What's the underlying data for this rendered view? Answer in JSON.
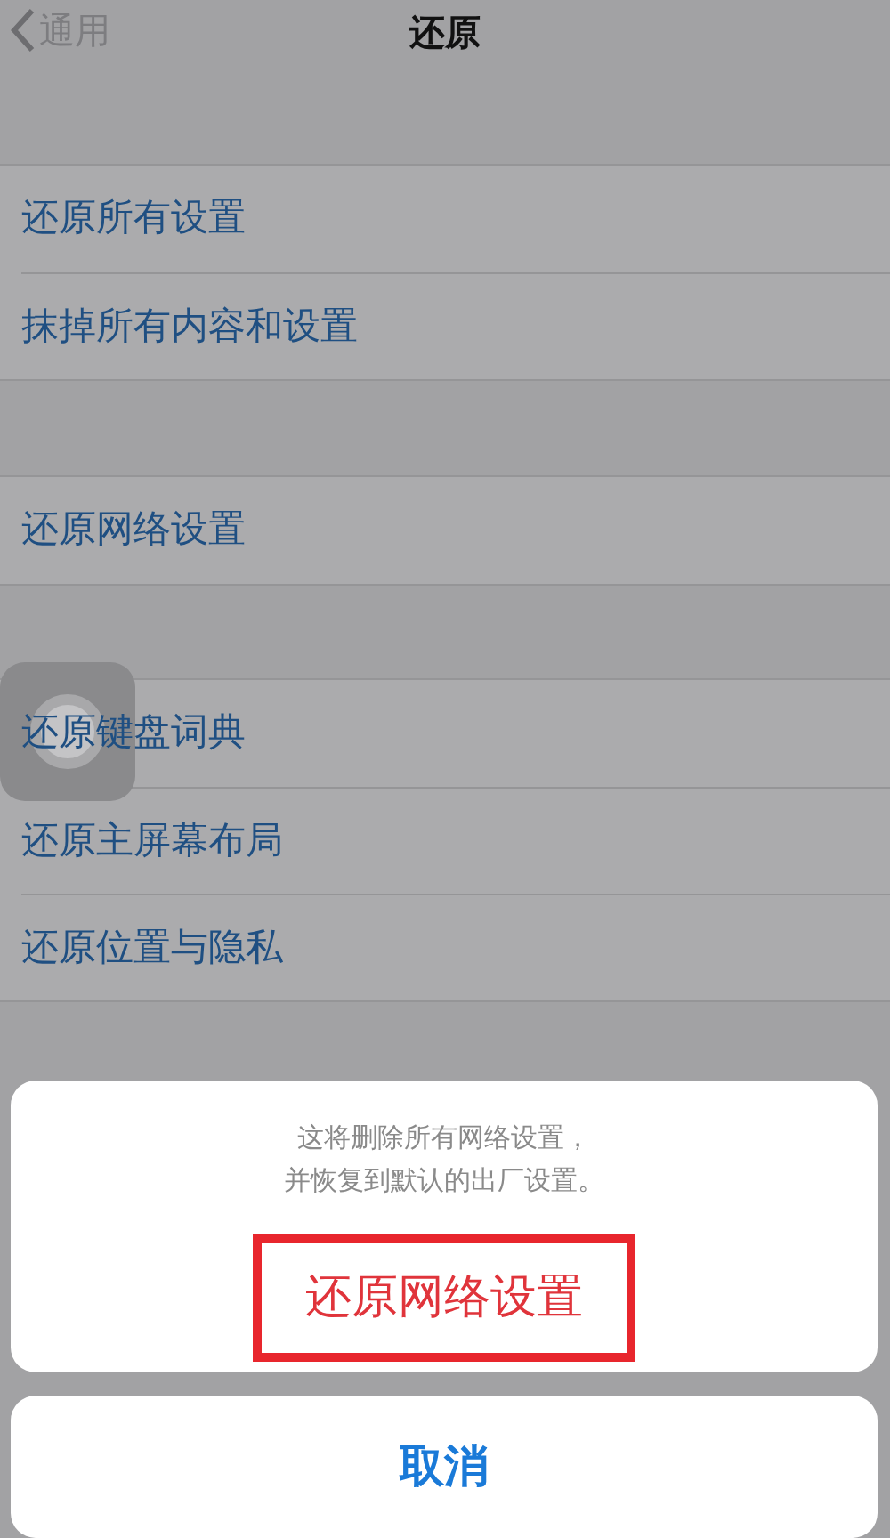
{
  "nav": {
    "back_label": "通用",
    "title": "还原"
  },
  "groups": [
    {
      "rows": [
        "还原所有设置",
        "抹掉所有内容和设置"
      ]
    },
    {
      "rows": [
        "还原网络设置"
      ]
    },
    {
      "rows": [
        "还原键盘词典",
        "还原主屏幕布局",
        "还原位置与隐私"
      ]
    }
  ],
  "action_sheet": {
    "message_lines": [
      "这将删除所有网络设置，",
      "并恢复到默认的出厂设置。"
    ],
    "action": {
      "label": "还原网络设置",
      "highlighted": true
    },
    "cancel": "取消"
  }
}
